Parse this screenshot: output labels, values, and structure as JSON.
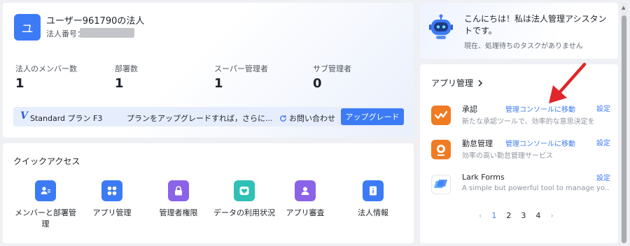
{
  "org": {
    "avatar_letter": "ユ",
    "name": "ユーザー961790の法人",
    "id_label": "法人番号："
  },
  "stats": [
    {
      "label": "法人のメンバー数",
      "value": "1"
    },
    {
      "label": "部署数",
      "value": "1"
    },
    {
      "label": "スーパー管理者",
      "value": "1"
    },
    {
      "label": "サブ管理者",
      "value": "0"
    }
  ],
  "plan": {
    "logo": "V",
    "name": "Standard プラン F3",
    "message": "プランをアップグレードすれば，さらに...",
    "contact_label": "お問い合わせ",
    "upgrade_label": "アップグレード"
  },
  "quick_access": {
    "title": "クイックアクセス",
    "items": [
      {
        "label": "メンバーと部署管理",
        "icon": "members-departments-icon",
        "color": "#3c7bf5"
      },
      {
        "label": "アプリ管理",
        "icon": "apps-grid-icon",
        "color": "#3c7bf5"
      },
      {
        "label": "管理者権限",
        "icon": "lock-icon",
        "color": "#8a63e8"
      },
      {
        "label": "データの利用状況",
        "icon": "data-heart-icon",
        "color": "#2fc1b5"
      },
      {
        "label": "アプリ審査",
        "icon": "user-review-icon",
        "color": "#8a63e8"
      },
      {
        "label": "法人情報",
        "icon": "org-info-icon",
        "color": "#3c7bf5"
      }
    ]
  },
  "assistant": {
    "greeting": "こんにちは！私は法人管理アシスタントです。",
    "tasks": "現在、処理待ちのタスクがありません"
  },
  "apps": {
    "title": "アプリ管理",
    "list": [
      {
        "name": "承認",
        "console": "管理コンソールに移動",
        "settings": "設定",
        "desc": "新たな承認ツールで、効率的な意思決定を",
        "icon": "approval-icon",
        "color": "#f07b22"
      },
      {
        "name": "勤怠管理",
        "console": "管理コンソールに移動",
        "settings": "設定",
        "desc": "効率の高い勤怠管理サービス",
        "icon": "attendance-icon",
        "color": "#f07b22"
      },
      {
        "name": "Lark Forms",
        "console": "",
        "settings": "設定",
        "desc": "A simple but powerful tool to manage yo...",
        "icon": "forms-icon",
        "color": "#3c7bf5"
      }
    ],
    "pagination": {
      "prev": "‹",
      "pages": [
        "1",
        "2",
        "3",
        "4"
      ],
      "next": "›"
    }
  }
}
